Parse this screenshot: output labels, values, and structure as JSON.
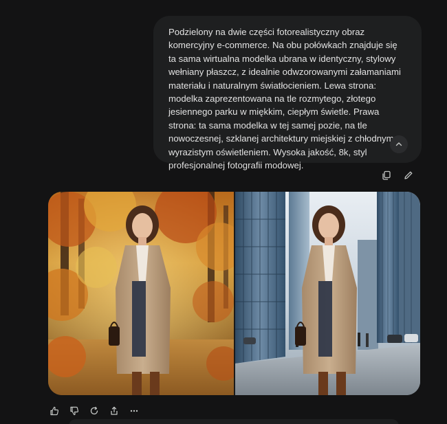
{
  "user_message": {
    "text": "Podzielony na dwie części fotorealistyczny obraz komercyjny e-commerce. Na obu połówkach znajduje się ta sama wirtualna modelka ubrana w identyczny, stylowy wełniany płaszcz, z idealnie odwzorowanymi załamaniami materiału i naturalnym światłocieniem. Lewa strona: modelka zaprezentowana na tle rozmytego, złotego jesiennego parku w miękkim, ciepłym świetle. Prawa strona: ta sama modelka w tej samej pozie, na tle nowoczesnej, szklanej architektury miejskiej z chłodnym, wyrazistym oświetleniem. Wysoka jakość, 8k, styl profesjonalnej fotografii modowej.",
    "actions": [
      "copy-icon",
      "edit-icon"
    ],
    "collapse_icon": "chevron-up-icon"
  },
  "generated_image": {
    "left_scene": "autumn-park",
    "right_scene": "glass-city"
  },
  "response_actions": [
    "thumbs-up-icon",
    "thumbs-down-icon",
    "regenerate-icon",
    "share-icon",
    "more-icon"
  ],
  "colors": {
    "background": "#131314",
    "bubble": "#1e1f20",
    "text": "#e3e3e3",
    "icon": "#c4c7c5"
  }
}
